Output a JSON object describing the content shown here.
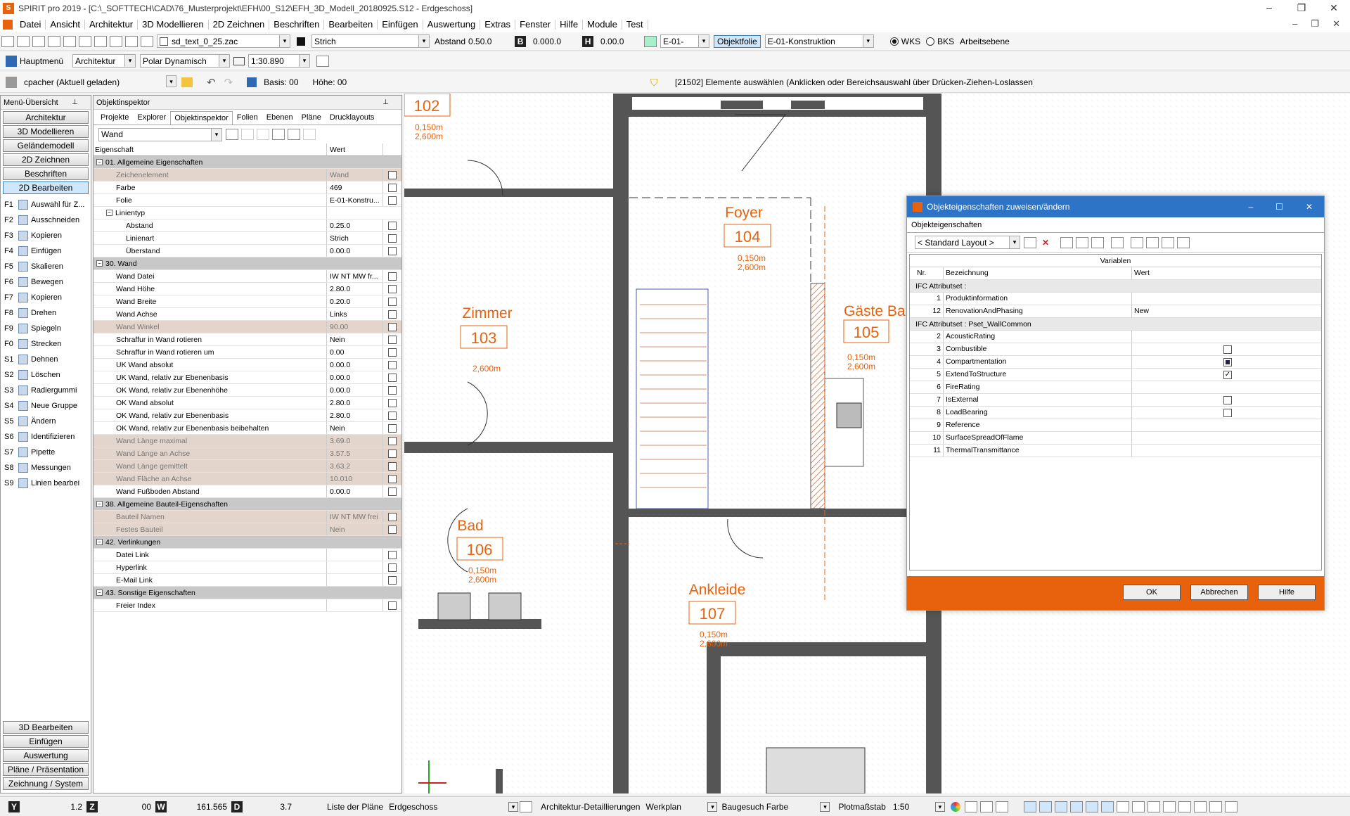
{
  "window": {
    "title": "SPIRIT pro 2019 - [C:\\_SOFTTECH\\CAD\\76_Musterprojekt\\EFH\\00_S12\\EFH_3D_Modell_20180925.S12 - Erdgeschoss]",
    "controls": [
      "–",
      "❐",
      "✕"
    ],
    "inner_controls": [
      "–",
      "❐",
      "✕"
    ]
  },
  "menu": [
    "Datei",
    "Ansicht",
    "Architektur",
    "3D Modellieren",
    "2D Zeichnen",
    "Beschriften",
    "Bearbeiten",
    "Einfügen",
    "Auswertung",
    "Extras",
    "Fenster",
    "Hilfe",
    "Module",
    "Test"
  ],
  "toolbar1": {
    "file": "sd_text_0_25.zac",
    "linetype": "Strich",
    "abstand_label": "Abstand",
    "abstand_value": "0.50.0",
    "b_label": "B",
    "b_value": "0.000.0",
    "h_label": "H",
    "h_value": "0.00.0",
    "layer_short": "E-01-",
    "objektfolie": "Objektfolie",
    "layer": "E-01-Konstruktion",
    "wks": "WKS",
    "bks": "BKS",
    "arbeitsebene": "Arbeitsebene"
  },
  "toolbar2": {
    "hauptmenu": "Hauptmenü",
    "mode": "Architektur",
    "snap": "Polar Dynamisch",
    "scale": "1:30.890"
  },
  "toolbar3": {
    "user": "cpacher (Aktuell geladen)",
    "basis": "Basis: 00",
    "hoehe": "Höhe: 00",
    "status": "[21502] Elemente auswählen (Anklicken oder Bereichsauswahl über Drücken-Ziehen-Loslassen)"
  },
  "menu_panel": {
    "title": "Menü-Übersicht",
    "buttons": [
      "Architektur",
      "3D Modellieren",
      "Geländemodell",
      "2D Zeichnen",
      "Beschriften",
      "2D Bearbeiten"
    ],
    "active": "2D Bearbeiten",
    "fkeys": [
      {
        "k": "F1",
        "l": "Auswahl für Z..."
      },
      {
        "k": "F2",
        "l": "Ausschneiden"
      },
      {
        "k": "F3",
        "l": "Kopieren"
      },
      {
        "k": "F4",
        "l": "Einfügen"
      },
      {
        "k": "F5",
        "l": "Skalieren"
      },
      {
        "k": "F6",
        "l": "Bewegen"
      },
      {
        "k": "F7",
        "l": "Kopieren"
      },
      {
        "k": "F8",
        "l": "Drehen"
      },
      {
        "k": "F9",
        "l": "Spiegeln"
      },
      {
        "k": "F0",
        "l": "Strecken"
      },
      {
        "k": "S1",
        "l": "Dehnen"
      },
      {
        "k": "S2",
        "l": "Löschen"
      },
      {
        "k": "S3",
        "l": "Radiergummi"
      },
      {
        "k": "S4",
        "l": "Neue Gruppe"
      },
      {
        "k": "S5",
        "l": "Ändern"
      },
      {
        "k": "S6",
        "l": "Identifizieren"
      },
      {
        "k": "S7",
        "l": "Pipette"
      },
      {
        "k": "S8",
        "l": "Messungen"
      },
      {
        "k": "S9",
        "l": "Linien bearbei"
      }
    ],
    "bottom_buttons": [
      "3D Bearbeiten",
      "Einfügen",
      "Auswertung",
      "Pläne / Präsentation",
      "Zeichnung / System"
    ]
  },
  "inspector": {
    "title": "Objektinspektor",
    "tabs": [
      "Projekte",
      "Explorer",
      "Objektinspektor",
      "Folien",
      "Ebenen",
      "Pläne",
      "Drucklayouts"
    ],
    "active_tab": "Objektinspektor",
    "object": "Wand",
    "col_prop": "Eigenschaft",
    "col_val": "Wert",
    "rows": [
      {
        "t": "grp",
        "p": "01. Allgemeine Eigenschaften"
      },
      {
        "t": "dis",
        "p": "Zeichenelement",
        "v": "Wand"
      },
      {
        "t": "n",
        "p": "Farbe",
        "v": "469"
      },
      {
        "t": "n",
        "p": "Folie",
        "v": "E-01-Konstru..."
      },
      {
        "t": "sgrp",
        "p": "Linientyp"
      },
      {
        "t": "sub",
        "p": "Abstand",
        "v": "0.25.0"
      },
      {
        "t": "sub",
        "p": "Linienart",
        "v": "Strich"
      },
      {
        "t": "sub",
        "p": "Überstand",
        "v": "0.00.0"
      },
      {
        "t": "grp",
        "p": "30. Wand"
      },
      {
        "t": "n",
        "p": "Wand Datei",
        "v": "IW NT MW fr..."
      },
      {
        "t": "n",
        "p": "Wand Höhe",
        "v": "2.80.0"
      },
      {
        "t": "n",
        "p": "Wand Breite",
        "v": "0.20.0"
      },
      {
        "t": "n",
        "p": "Wand Achse",
        "v": "Links"
      },
      {
        "t": "dis",
        "p": "Wand Winkel",
        "v": "90.00"
      },
      {
        "t": "n",
        "p": "Schraffur in Wand rotieren",
        "v": "Nein"
      },
      {
        "t": "n",
        "p": "Schraffur in Wand rotieren um",
        "v": "0.00"
      },
      {
        "t": "n",
        "p": "UK Wand absolut",
        "v": "0.00.0"
      },
      {
        "t": "n",
        "p": "UK Wand, relativ zur Ebenenbasis",
        "v": "0.00.0"
      },
      {
        "t": "n",
        "p": "OK Wand, relativ zur Ebenenhöhe",
        "v": "0.00.0"
      },
      {
        "t": "n",
        "p": "OK Wand absolut",
        "v": "2.80.0"
      },
      {
        "t": "n",
        "p": "OK Wand, relativ zur Ebenenbasis",
        "v": "2.80.0"
      },
      {
        "t": "n",
        "p": "OK Wand, relativ zur Ebenenbasis beibehalten",
        "v": "Nein"
      },
      {
        "t": "dis",
        "p": "Wand Länge maximal",
        "v": "3.69.0"
      },
      {
        "t": "dis",
        "p": "Wand Länge an Achse",
        "v": "3.57.5"
      },
      {
        "t": "dis",
        "p": "Wand Länge gemittelt",
        "v": "3.63.2"
      },
      {
        "t": "dis",
        "p": "Wand Fläche an Achse",
        "v": "10.010"
      },
      {
        "t": "n",
        "p": "Wand Fußboden Abstand",
        "v": "0.00.0"
      },
      {
        "t": "grp",
        "p": "38. Allgemeine Bauteil-Eigenschaften"
      },
      {
        "t": "dis",
        "p": "Bauteil Namen",
        "v": "IW NT MW frei"
      },
      {
        "t": "dis",
        "p": "Festes Bauteil",
        "v": "Nein"
      },
      {
        "t": "grp",
        "p": "42. Verlinkungen"
      },
      {
        "t": "n",
        "p": "Datei Link",
        "v": ""
      },
      {
        "t": "n",
        "p": "Hyperlink",
        "v": ""
      },
      {
        "t": "n",
        "p": "E-Mail Link",
        "v": ""
      },
      {
        "t": "grp",
        "p": "43. Sonstige Eigenschaften"
      },
      {
        "t": "n",
        "p": "Freier Index",
        "v": ""
      }
    ]
  },
  "rooms": [
    {
      "name": "",
      "num": "102",
      "d": "0,150m",
      "h": "2,600m"
    },
    {
      "name": "Foyer",
      "num": "104",
      "d": "0,150m",
      "h": "2,600m"
    },
    {
      "name": "Zimmer",
      "num": "103",
      "d": "",
      "h": "2,600m"
    },
    {
      "name": "Gäste Ba",
      "num": "105",
      "d": "0,150m",
      "h": "2,600m"
    },
    {
      "name": "Bad",
      "num": "106",
      "d": "0,150m",
      "h": "2,600m"
    },
    {
      "name": "Ankleide",
      "num": "107",
      "d": "0,150m",
      "h": "2,600m"
    }
  ],
  "dialog": {
    "title": "Objekteigenschaften zuweisen/ändern",
    "tab": "Objekteigenschaften",
    "layout": "< Standard Layout >",
    "variablen": "Variablen",
    "col_nr": "Nr.",
    "col_bez": "Bezeichnung",
    "col_wert": "Wert",
    "rows": [
      {
        "g": "IFC Attributset :"
      },
      {
        "n": "1",
        "b": "Produktinformation",
        "w": ""
      },
      {
        "n": "12",
        "b": "RenovationAndPhasing",
        "w": "New"
      },
      {
        "g": "IFC Attributset : Pset_WallCommon"
      },
      {
        "n": "2",
        "b": "AcousticRating",
        "w": ""
      },
      {
        "n": "3",
        "b": "Combustible",
        "w": "",
        "c": "empty"
      },
      {
        "n": "4",
        "b": "Compartmentation",
        "w": "",
        "c": "filled"
      },
      {
        "n": "5",
        "b": "ExtendToStructure",
        "w": "",
        "c": "check"
      },
      {
        "n": "6",
        "b": "FireRating",
        "w": ""
      },
      {
        "n": "7",
        "b": "IsExternal",
        "w": "",
        "c": "empty"
      },
      {
        "n": "8",
        "b": "LoadBearing",
        "w": "",
        "c": "empty"
      },
      {
        "n": "9",
        "b": "Reference",
        "w": ""
      },
      {
        "n": "10",
        "b": "SurfaceSpreadOfFlame",
        "w": ""
      },
      {
        "n": "11",
        "b": "ThermalTransmittance",
        "w": ""
      }
    ],
    "ok": "OK",
    "cancel": "Abbrechen",
    "help": "Hilfe"
  },
  "status": {
    "y_label": "Y",
    "y": "1.2",
    "z_label": "Z",
    "z": "00",
    "w_label": "W",
    "w": "161.565",
    "d_label": "D",
    "d": "3.7",
    "plans": "Liste der Pläne",
    "floor": "Erdgeschoss",
    "detail": "Architektur-Detaillierungen",
    "werkplan": "Werkplan",
    "farbe": "Baugesuch Farbe",
    "plot_label": "Plotmaßstab",
    "plot": "1:50"
  }
}
